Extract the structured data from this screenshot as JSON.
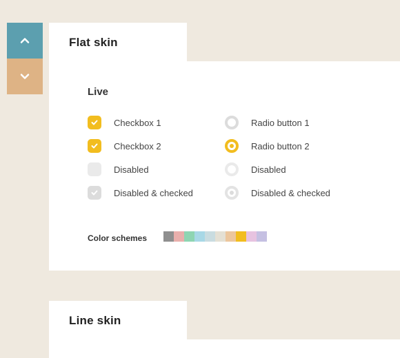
{
  "nav": {
    "up": "up",
    "down": "down"
  },
  "skins": {
    "flat": {
      "title": "Flat skin",
      "section": "Live",
      "checkboxes": [
        {
          "label": "Checkbox 1",
          "checked": true,
          "disabled": false
        },
        {
          "label": "Checkbox 2",
          "checked": true,
          "disabled": false
        },
        {
          "label": "Disabled",
          "checked": false,
          "disabled": true
        },
        {
          "label": "Disabled & checked",
          "checked": true,
          "disabled": true
        }
      ],
      "radios": [
        {
          "label": "Radio button 1",
          "checked": false,
          "disabled": false
        },
        {
          "label": "Radio button 2",
          "checked": true,
          "disabled": false
        },
        {
          "label": "Disabled",
          "checked": false,
          "disabled": true
        },
        {
          "label": "Disabled & checked",
          "checked": true,
          "disabled": true
        }
      ],
      "color_schemes_label": "Color schemes",
      "color_schemes": [
        "#8f8f8f",
        "#e9afac",
        "#8ed5b2",
        "#a8d8e6",
        "#c9dce0",
        "#e4e0d4",
        "#ecc69d",
        "#f2bd1f",
        "#e7c3e0",
        "#c5c0e2"
      ]
    },
    "line": {
      "title": "Line skin"
    }
  }
}
